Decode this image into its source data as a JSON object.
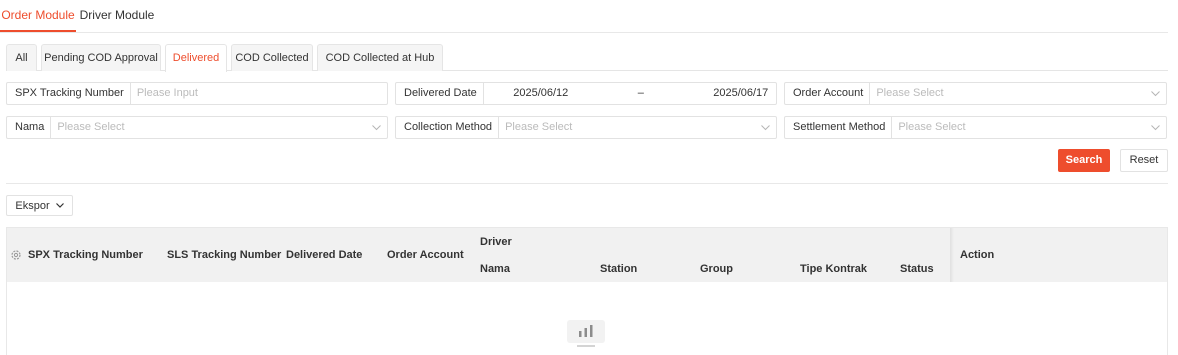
{
  "module_tabs": [
    "Order Module",
    "Driver Module"
  ],
  "status_tabs": [
    "All",
    "Pending COD Approval",
    "Delivered",
    "COD Collected",
    "COD Collected at Hub"
  ],
  "filters": {
    "spx_tracking": {
      "label": "SPX Tracking Number",
      "placeholder": "Please Input"
    },
    "delivered_date": {
      "label": "Delivered Date",
      "start": "2025/06/12",
      "separator": "–",
      "end": "2025/06/17"
    },
    "order_account": {
      "label": "Order Account",
      "placeholder": "Please Select"
    },
    "nama": {
      "label": "Nama",
      "placeholder": "Please Select"
    },
    "collection_method": {
      "label": "Collection Method",
      "placeholder": "Please Select"
    },
    "settlement_method": {
      "label": "Settlement Method",
      "placeholder": "Please Select"
    }
  },
  "buttons": {
    "search": "Search",
    "reset": "Reset",
    "export": "Ekspor"
  },
  "table": {
    "columns": {
      "spx": "SPX Tracking Number",
      "sls": "SLS Tracking Number",
      "delivered_date": "Delivered Date",
      "order_account": "Order Account",
      "driver": "Driver",
      "nama": "Nama",
      "station": "Station",
      "group": "Group",
      "tipe_kontrak": "Tipe Kontrak",
      "status": "Status",
      "action": "Action"
    },
    "rows": []
  },
  "colors": {
    "accent": "#ee4d2d",
    "header_bg": "#f1f1f1",
    "border": "#e2e2e2"
  },
  "icons": [
    "chevron-down-icon",
    "calendar-icon",
    "gear-icon",
    "empty-data-icon"
  ]
}
